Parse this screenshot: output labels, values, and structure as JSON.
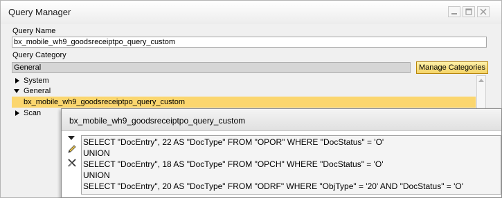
{
  "window": {
    "title": "Query Manager",
    "buttons": [
      "minimize-icon",
      "maximize-icon",
      "close-icon"
    ]
  },
  "form": {
    "query_name_label": "Query Name",
    "query_name_value": "bx_mobile_wh9_goodsreceiptpo_query_custom",
    "query_category_label": "Query Category",
    "query_category_value": "General",
    "manage_categories_label": "Manage Categories"
  },
  "tree": {
    "items": [
      {
        "label": "System",
        "state": "collapsed"
      },
      {
        "label": "General",
        "state": "expanded"
      },
      {
        "label": "bx_mobile_wh9_goodsreceiptpo_query_custom",
        "state": "selected"
      },
      {
        "label": "Scan",
        "state": "collapsed"
      }
    ]
  },
  "popup": {
    "title": "bx_mobile_wh9_goodsreceiptpo_query_custom",
    "icons": [
      "expand-arrow-icon",
      "pencil-icon",
      "delete-icon"
    ],
    "sql_lines": [
      "SELECT \"DocEntry\", 22 AS \"DocType\" FROM \"OPOR\" WHERE \"DocStatus\" = 'O'",
      "UNION",
      "SELECT \"DocEntry\", 18 AS \"DocType\" FROM \"OPCH\" WHERE \"DocStatus\" = 'O'",
      "UNION",
      "SELECT \"DocEntry\", 20 AS \"DocType\" FROM \"ODRF\" WHERE \"ObjType\" = '20' AND \"DocStatus\" = 'O'"
    ]
  },
  "colors": {
    "selection": "#fbd66e",
    "button": "#f4d468"
  }
}
